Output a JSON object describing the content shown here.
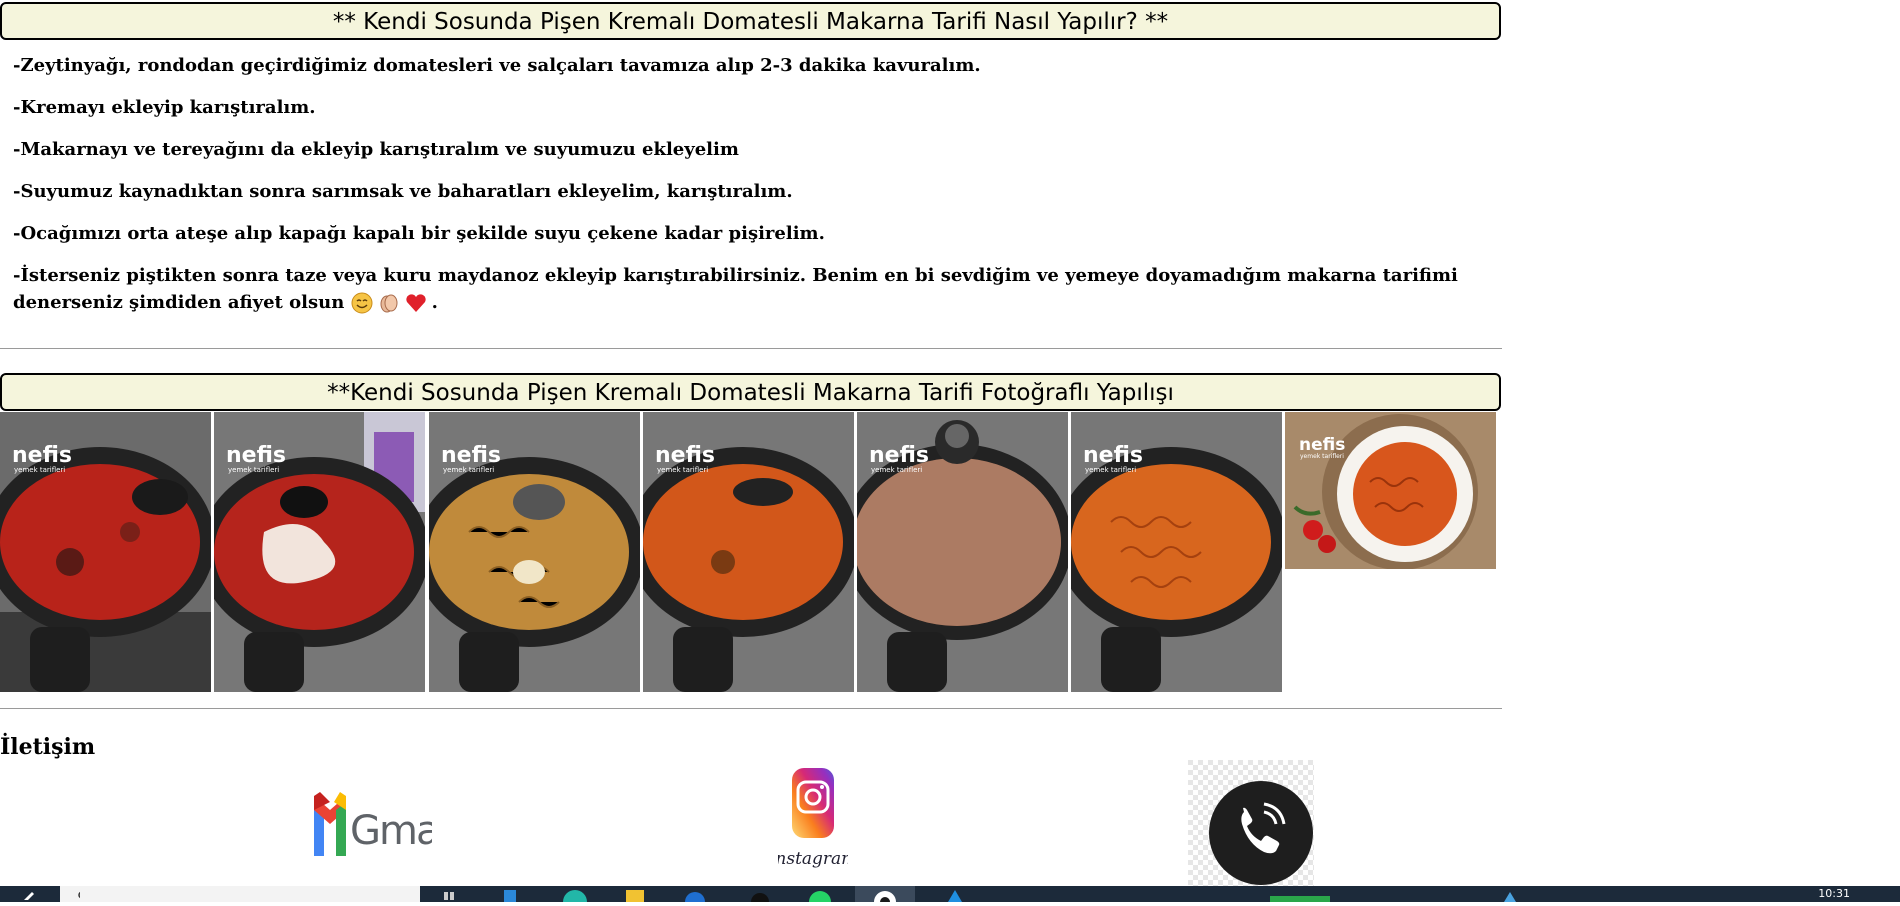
{
  "recipe_header": {
    "title": "** Kendi Sosunda Pişen Kremalı Domatesli Makarna Tarifi Nasıl Yapılır? **"
  },
  "steps": [
    "-Zeytinyağı, rondodan geçirdiğimiz domatesleri ve salçaları tavamıza alıp 2-3 dakika kavuralım.",
    "-Kremayı ekleyip karıştıralım.",
    "-Makarnayı ve tereyağını da ekleyip karıştıralım ve suyumuzu ekleyelim",
    "-Suyumuz kaynadıktan sonra sarımsak ve baharatları ekleyelim, karıştıralım.",
    "-Ocağımızı orta ateşe alıp kapağı kapalı bir şekilde suyu çekene kadar pişirelim.",
    "-İsterseniz piştikten sonra taze veya kuru maydanoz ekleyip karıştırabilirsiniz. Benim en bi sevdiğim ve yemeye doyamadığım makarna tarifimi denerseniz şimdiden afiyet olsun",
    "."
  ],
  "photos_header": {
    "title": "**Kendi Sosunda Pişen Kremalı Domatesli Makarna Tarifi Fotoğraflı Yapılışı"
  },
  "photos": {
    "watermark": "nefis",
    "watermark_sub": "yemek tarifleri",
    "items": [
      "photo-step-1",
      "photo-step-2",
      "photo-step-3",
      "photo-step-4",
      "photo-step-5",
      "photo-step-6",
      "photo-final"
    ]
  },
  "contact": {
    "title": "İletişim",
    "gmail_label": "Gmail",
    "instagram_label": "Instagram"
  },
  "taskbar": {
    "clock": "10:31"
  },
  "colors": {
    "header_bg": "#f5f5dc",
    "taskbar": "#1c2a3a"
  }
}
